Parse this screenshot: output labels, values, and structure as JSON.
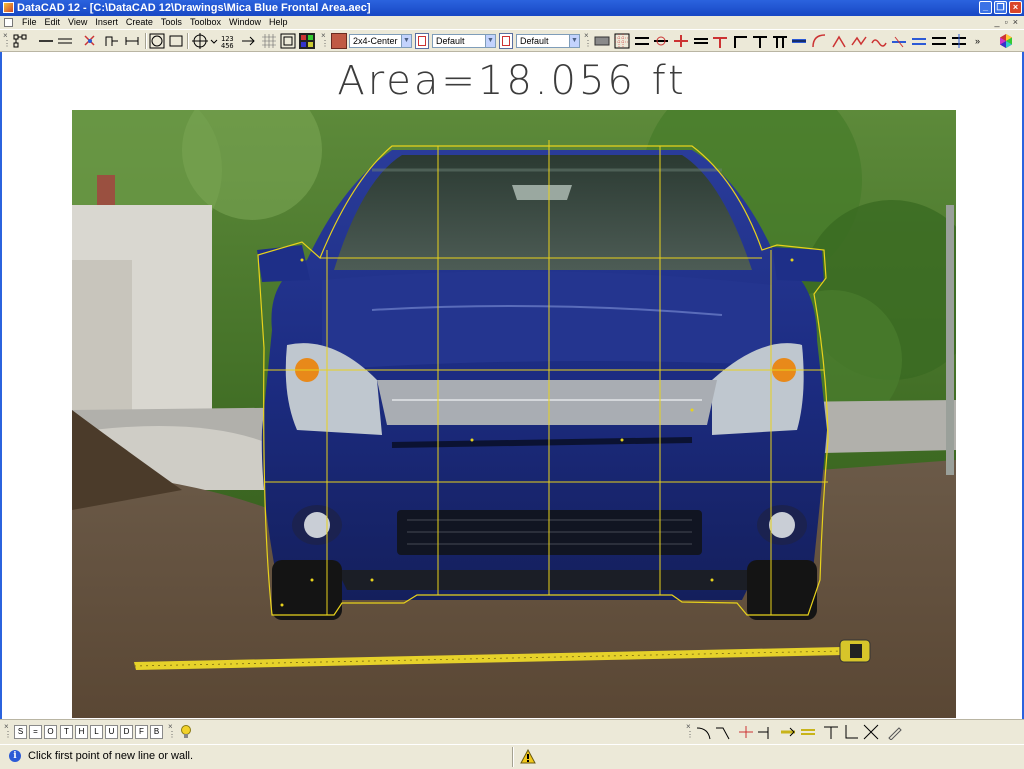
{
  "window": {
    "title": "DataCAD 12 - [C:\\DataCAD 12\\Drawings\\Mica Blue Frontal Area.aec]",
    "buttons": [
      "minimize-icon",
      "restore-icon",
      "close-icon"
    ]
  },
  "menubar": {
    "items": [
      "File",
      "Edit",
      "View",
      "Insert",
      "Create",
      "Tools",
      "Toolbox",
      "Window",
      "Help"
    ],
    "mdi_buttons": [
      "_",
      "▫",
      "×"
    ]
  },
  "toolbar": {
    "snap_combo": "2x4-Center",
    "linetype_combo": "Default",
    "layer_combo": "Default"
  },
  "drawing": {
    "area_label": "Area=18.056  ft",
    "photo_subject": "Blue hatchback car front view with yellow area trace",
    "outline_color": "#e8d21c"
  },
  "bottom_toolbar": {
    "keys": [
      "S",
      "=",
      "O",
      "T",
      "H",
      "L",
      "U",
      "D",
      "F",
      "B"
    ]
  },
  "status": {
    "message": "Click first point of new line or wall."
  },
  "colors": {
    "titlebar": "#1747c4",
    "chrome": "#ece9d8",
    "car_body": "#1b2a7a",
    "trace": "#e8d21c"
  }
}
